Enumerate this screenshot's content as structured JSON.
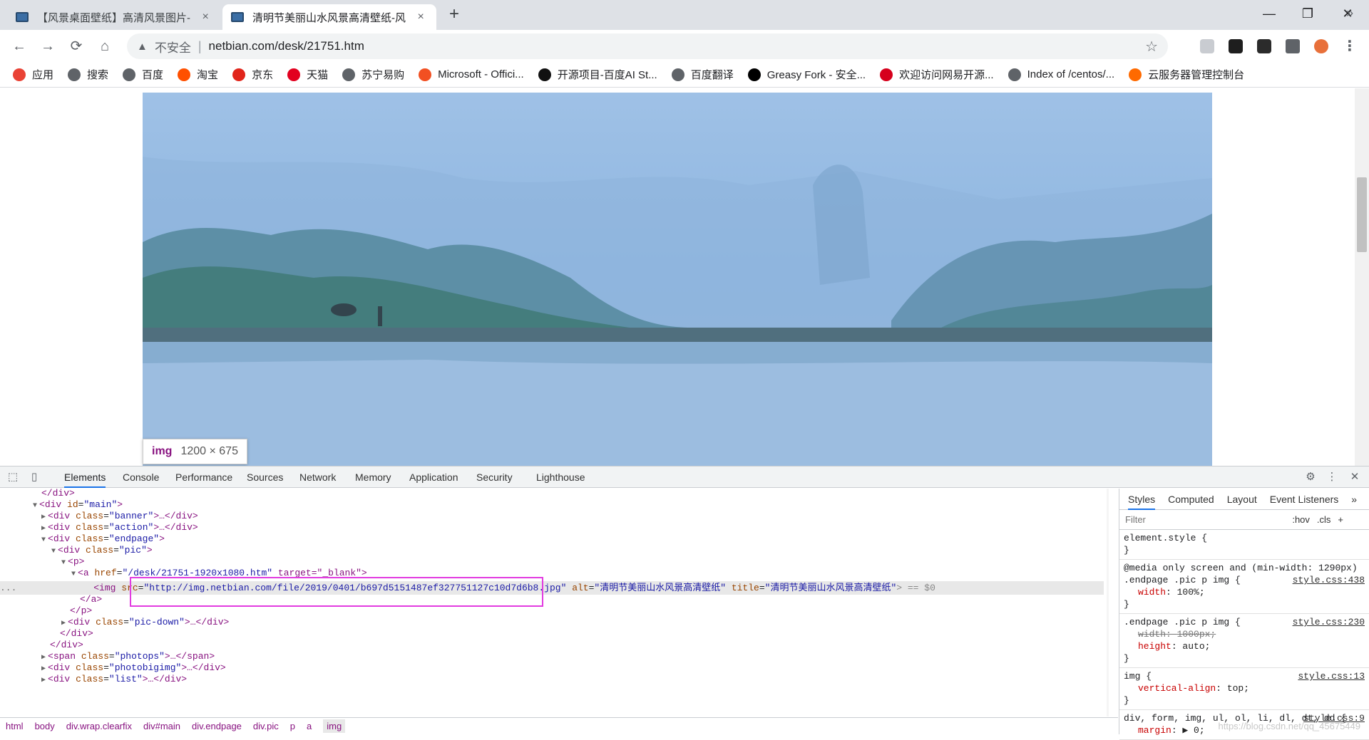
{
  "tabs": [
    {
      "title": "【风景桌面壁纸】高清风景图片-",
      "close": "×"
    },
    {
      "title": "清明节美丽山水风景高清壁纸-风",
      "close": "×"
    }
  ],
  "new_tab": "+",
  "window_controls": {
    "minimize": "—",
    "restore": "❐",
    "close": "✕"
  },
  "toolbar": {
    "back": "←",
    "forward": "→",
    "reload": "⟳",
    "home": "⌂",
    "security_icon": "▲",
    "security_text": "不安全",
    "separator": "|",
    "url": "netbian.com/desk/21751.htm",
    "star": "☆",
    "menu": "⋮"
  },
  "bookmarks": [
    {
      "label": "应用",
      "color": "#e94235"
    },
    {
      "label": "搜索",
      "color": "#5f6368"
    },
    {
      "label": "百度",
      "color": "#5f6368"
    },
    {
      "label": "淘宝",
      "color": "#ff5000"
    },
    {
      "label": "京东",
      "color": "#e1251b"
    },
    {
      "label": "天猫",
      "color": "#e2001f"
    },
    {
      "label": "苏宁易购",
      "color": "#5f6368"
    },
    {
      "label": "Microsoft - Offici...",
      "color": "#f25022"
    },
    {
      "label": "开源项目-百度AI St...",
      "color": "#111111"
    },
    {
      "label": "百度翻译",
      "color": "#5f6368"
    },
    {
      "label": "Greasy Fork - 安全...",
      "color": "#000000"
    },
    {
      "label": "欢迎访问网易开源...",
      "color": "#d6001c"
    },
    {
      "label": "Index of /centos/...",
      "color": "#5f6368"
    },
    {
      "label": "云服务器管理控制台",
      "color": "#ff6a00"
    }
  ],
  "bookmarks_more": "»",
  "page": {
    "tooltip_tag": "img",
    "tooltip_dims": "1200 × 675"
  },
  "devtools": {
    "tabs": [
      "Elements",
      "Console",
      "Performance",
      "Sources",
      "Network",
      "Memory",
      "Application",
      "Security",
      "Lighthouse"
    ],
    "active_tab": "Elements",
    "settings": "⚙",
    "more": "⋮",
    "close": "✕",
    "dom_lines": [
      {
        "indent": 58,
        "text": "</div>",
        "kind": "closing"
      },
      {
        "indent": 46,
        "arrow": "▼",
        "open": "<div",
        "attr": "id",
        "value": "\"main\"",
        "close": ">"
      },
      {
        "indent": 58,
        "arrow": "▶",
        "open": "<div",
        "attr": "class",
        "value": "\"banner\"",
        "close": ">…</div>"
      },
      {
        "indent": 58,
        "arrow": "▶",
        "open": "<div",
        "attr": "class",
        "value": "\"action\"",
        "close": ">…</div>"
      },
      {
        "indent": 58,
        "arrow": "▼",
        "open": "<div",
        "attr": "class",
        "value": "\"endpage\"",
        "close": ">"
      },
      {
        "indent": 72,
        "arrow": "▼",
        "open": "<div",
        "attr": "class",
        "value": "\"pic\"",
        "close": ">"
      },
      {
        "indent": 86,
        "arrow": "▼",
        "open": "<p>",
        "attr": "",
        "value": "",
        "close": ""
      },
      {
        "indent": 100,
        "arrow": "▼",
        "open": "<a",
        "attr": "href",
        "value": "\"/desk/21751-1920x1080.htm\"",
        "close": " target=\"_blank\">"
      }
    ],
    "selected_line": {
      "tag_open": "<img",
      "attr_src": "src",
      "src": "\"http://img.netbian.com/file/2019/0401/b697d5151487ef327751127c10d7d6b8.jpg\"",
      "attr_alt": "alt",
      "alt": "\"清明节美丽山水风景高清壁纸\"",
      "attr_title": "title",
      "title": "\"清明节美丽山水风景高清壁纸\"",
      "tail": "> == $0",
      "dots": "..."
    },
    "dom_lines_after": [
      {
        "indent": 112,
        "text": "</a>"
      },
      {
        "indent": 98,
        "text": "</p>"
      },
      {
        "indent": 86,
        "arrow": "▶",
        "open": "<div",
        "attr": "class",
        "value": "\"pic-down\"",
        "close": ">…</div>"
      },
      {
        "indent": 84,
        "text": "</div>"
      },
      {
        "indent": 70,
        "text": "</div>"
      },
      {
        "indent": 58,
        "arrow": "▶",
        "open": "<span",
        "attr": "class",
        "value": "\"photops\"",
        "close": ">…</span>"
      },
      {
        "indent": 58,
        "arrow": "▶",
        "open": "<div",
        "attr": "class",
        "value": "\"photobigimg\"",
        "close": ">…</div>"
      },
      {
        "indent": 58,
        "arrow": "▶",
        "open": "<div",
        "attr": "class",
        "value": "\"list\"",
        "close": ">…</div>"
      }
    ],
    "breadcrumbs": [
      "html",
      "body",
      "div.wrap.clearfix",
      "div#main",
      "div.endpage",
      "div.pic",
      "p",
      "a",
      "img"
    ],
    "styles": {
      "tabs": [
        "Styles",
        "Computed",
        "Layout",
        "Event Listeners"
      ],
      "more": "»",
      "filter_placeholder": "Filter",
      "hov": ":hov",
      "cls": ".cls",
      "plus": "+",
      "rules": [
        {
          "media": "",
          "selector": "element.style {",
          "source": "",
          "props": [],
          "end": "}"
        },
        {
          "media": "@media only screen and (min-width: 1290px)",
          "selector": ".endpage .pic p img {",
          "source": "style.css:438",
          "props": [
            {
              "name": "width",
              "value": "100%;",
              "struck": false
            }
          ],
          "end": "}"
        },
        {
          "media": "",
          "selector": ".endpage .pic p img {",
          "source": "style.css:230",
          "props": [
            {
              "name": "width",
              "value": "1000px;",
              "struck": true
            },
            {
              "name": "height",
              "value": "auto;",
              "struck": false
            }
          ],
          "end": "}"
        },
        {
          "media": "",
          "selector": "img {",
          "source": "style.css:13",
          "props": [
            {
              "name": "vertical-align",
              "value": "top;",
              "struck": false
            }
          ],
          "end": "}"
        },
        {
          "media": "",
          "selector": "div, form, img, ul, ol, li, dl, dt, dd {",
          "source": "style.css:9",
          "props": [
            {
              "name": "margin",
              "value": "▶ 0;",
              "struck": false
            }
          ],
          "end": ""
        }
      ],
      "watermark": "https://blog.csdn.net/qq_45675449"
    }
  }
}
